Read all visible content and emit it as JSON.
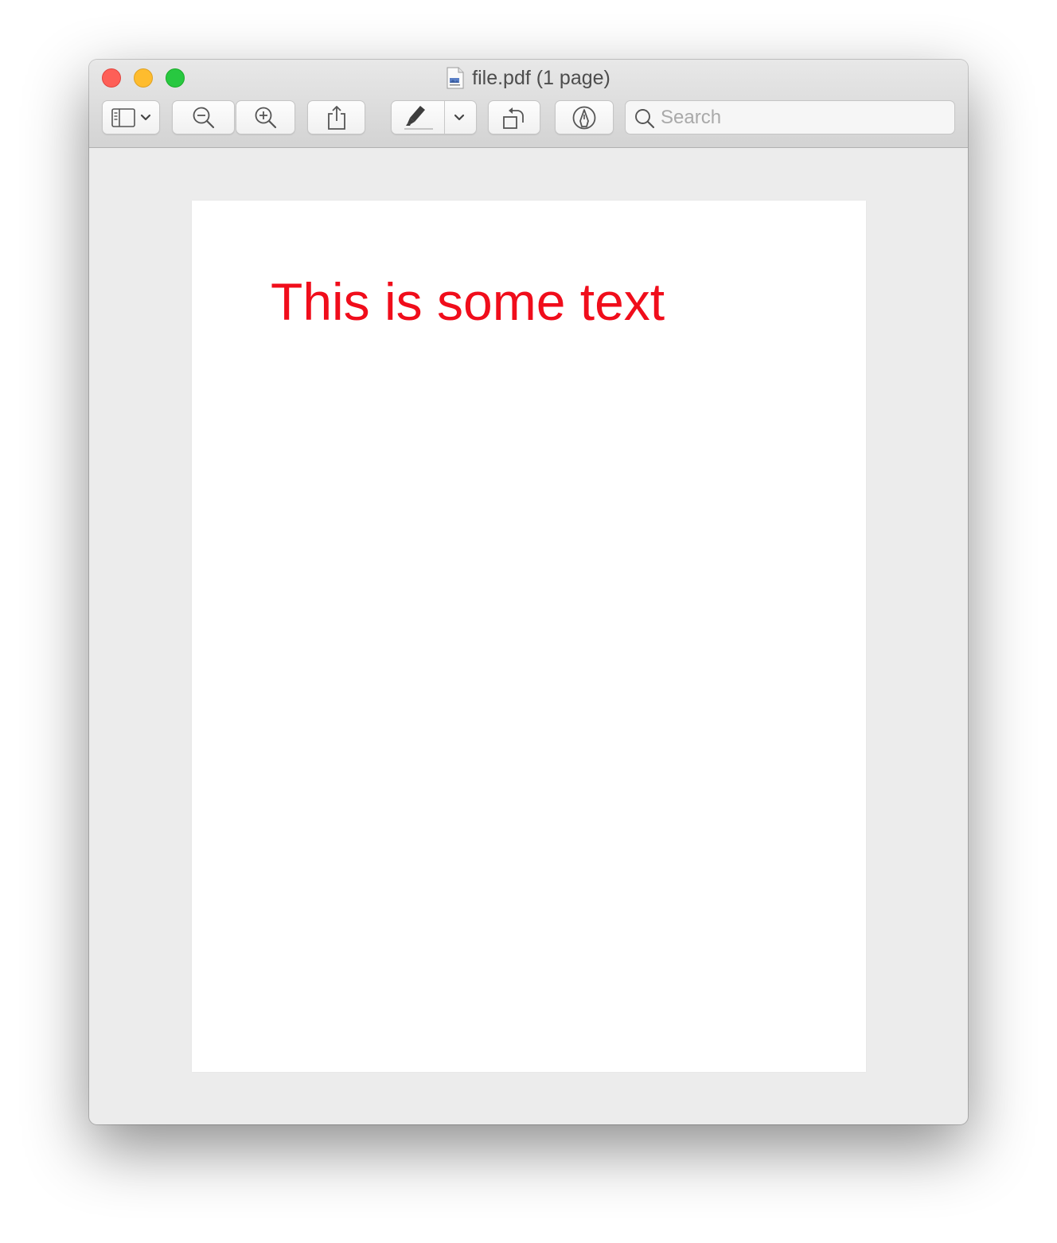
{
  "window": {
    "title": "file.pdf (1 page)",
    "document_icon": "pdf-document-icon"
  },
  "traffic_lights": {
    "close_color": "#fe5f57",
    "minimize_color": "#febc2e",
    "zoom_color": "#28c840"
  },
  "toolbar": {
    "sidebar_icon": "sidebar-icon",
    "sidebar_dropdown_icon": "chevron-down-icon",
    "zoom_out_icon": "zoom-out-icon",
    "zoom_in_icon": "zoom-in-icon",
    "share_icon": "share-icon",
    "highlight_icon": "highlighter-icon",
    "highlight_dropdown_icon": "chevron-down-icon",
    "rotate_icon": "rotate-left-icon",
    "markup_icon": "markup-pen-icon"
  },
  "search": {
    "placeholder": "Search",
    "value": ""
  },
  "document": {
    "text": "This is some text",
    "text_color": "#f00d1b"
  }
}
